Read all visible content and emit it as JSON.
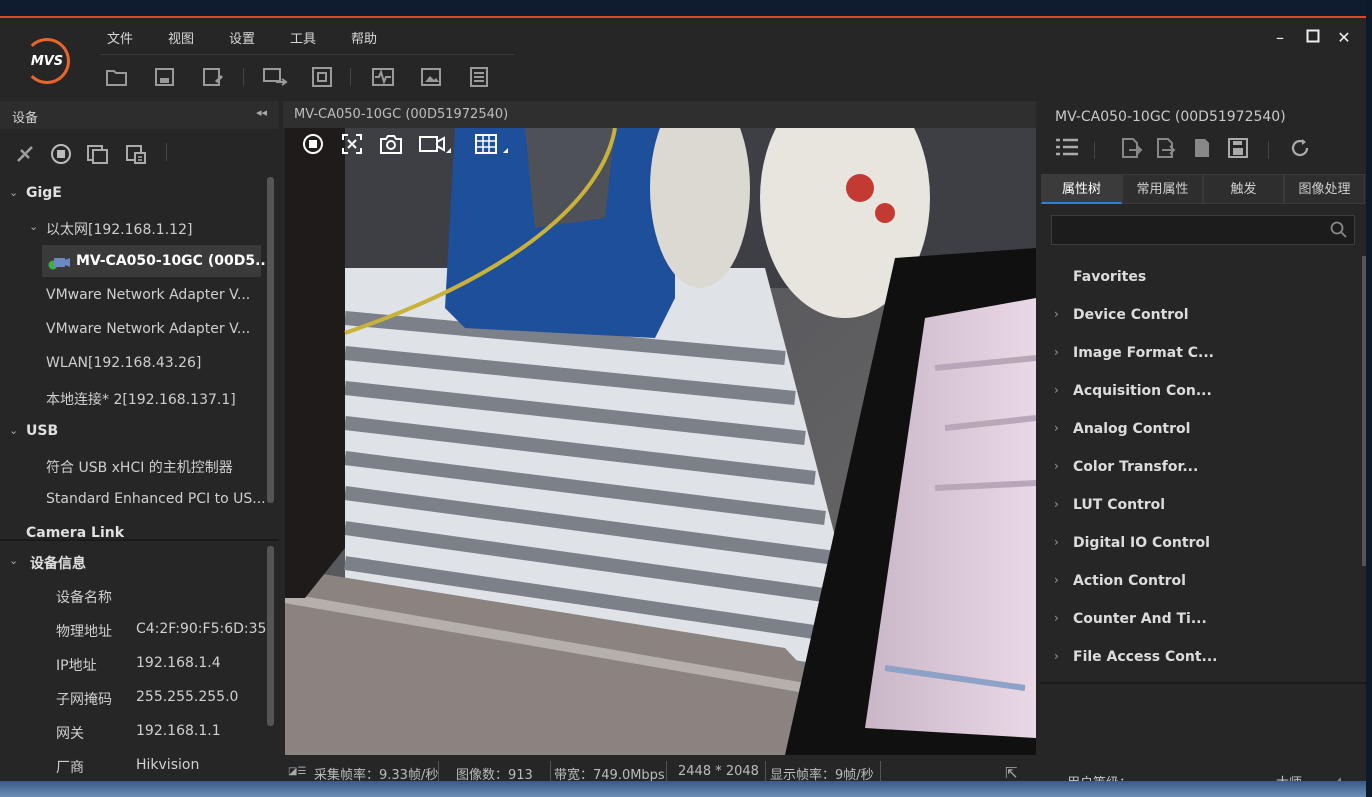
{
  "menu": {
    "file": "文件",
    "view": "视图",
    "settings": "设置",
    "tools": "工具",
    "help": "帮助"
  },
  "logo_text": "MVS",
  "left_panel": {
    "title": "设备",
    "tree": {
      "gige": "GigE",
      "ethernet": "以太网[192.168.1.12]",
      "camera": "MV-CA050-10GC (00D5...",
      "vmware1": "VMware Network Adapter V...",
      "vmware2": "VMware Network Adapter V...",
      "wlan": "WLAN[192.168.43.26]",
      "local": "本地连接* 2[192.168.137.1]",
      "usb": "USB",
      "usb1": "符合 USB xHCI 的主机控制器",
      "usb2": "Standard Enhanced PCI to US...",
      "cameralink": "Camera Link"
    },
    "info": {
      "title": "设备信息",
      "rows": [
        {
          "label": "设备名称",
          "value": ""
        },
        {
          "label": "物理地址",
          "value": "C4:2F:90:F5:6D:35"
        },
        {
          "label": "IP地址",
          "value": "192.168.1.4"
        },
        {
          "label": "子网掩码",
          "value": "255.255.255.0"
        },
        {
          "label": "网关",
          "value": "192.168.1.1"
        },
        {
          "label": "厂商",
          "value": "Hikvision"
        }
      ]
    }
  },
  "center": {
    "title": "MV-CA050-10GC (00D51972540)",
    "status": {
      "fps": "采集帧率：9.33帧/秒",
      "count": "图像数：913",
      "bandwidth": "带宽：749.0Mbps",
      "resolution": "2448 * 2048",
      "display_fps": "显示帧率：9帧/秒"
    }
  },
  "right_panel": {
    "title": "MV-CA050-10GC (00D51972540)",
    "tabs": [
      "属性树",
      "常用属性",
      "触发",
      "图像处理"
    ],
    "search_placeholder": "",
    "favorites": "Favorites",
    "properties": [
      "Device Control",
      "Image Format C...",
      "Acquisition Con...",
      "Analog Control",
      "Color Transfor...",
      "LUT Control",
      "Digital IO Control",
      "Action Control",
      "Counter And Ti...",
      "File Access Cont..."
    ],
    "user_level_label": "用户等级：",
    "user_level_value": "大师"
  },
  "colors": {
    "accent": "#2f80d1",
    "brand": "#e8662d",
    "background": "#262626"
  }
}
